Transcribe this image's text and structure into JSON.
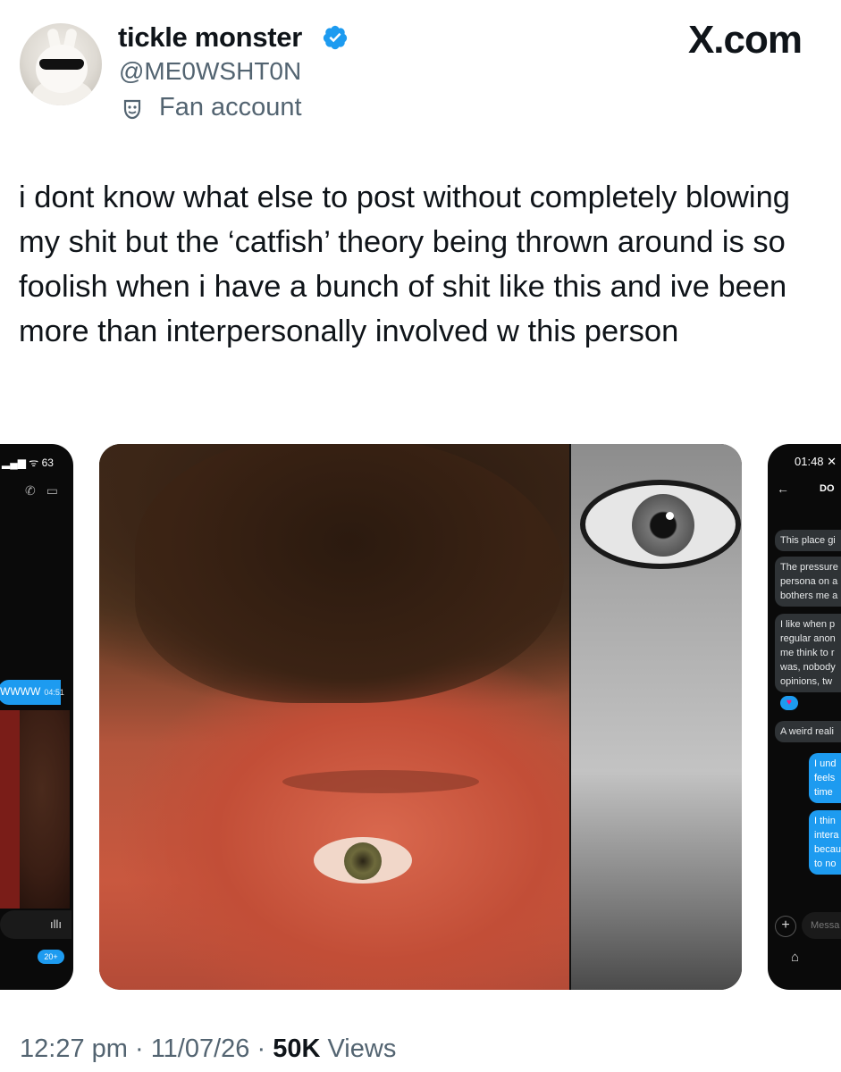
{
  "brand": "X.com",
  "author": {
    "name": "tickle monster",
    "handle": "@ME0WSHT0N",
    "label": "Fan account",
    "verified": true,
    "avatar_icon": "bunny-with-sunglasses-avatar"
  },
  "post": {
    "text": "i dont know what else to post without completely blowing my shit but the ‘catfish’ theory being thrown around is so foolish when i have a bunch of shit like this and ive been more than interpersonally involved w this person"
  },
  "media": {
    "left_phone": {
      "status": "63",
      "sent_text": "WWWW",
      "sent_time": "04:51",
      "badge": "20+"
    },
    "right_phone": {
      "time": "01:48",
      "title": "DO",
      "messages": [
        [
          "This place gi"
        ],
        [
          "The pressure",
          "persona on a",
          "bothers me a"
        ],
        [
          "I like when p",
          "regular anon",
          "me think to r",
          "was, nobody",
          "opinions, tw"
        ],
        [
          "A weird reali"
        ]
      ],
      "sent": [
        [
          "I und",
          "feels",
          "time"
        ],
        [
          "I thin",
          "intera",
          "becau",
          "to no"
        ]
      ],
      "input_placeholder": "Messa"
    }
  },
  "meta": {
    "time": "12:27 pm",
    "date": "11/07/26",
    "views_count": "50K",
    "views_label": "Views"
  },
  "colors": {
    "accent": "#1d9bf0",
    "secondary_text": "#536471",
    "primary_text": "#0f1419"
  }
}
